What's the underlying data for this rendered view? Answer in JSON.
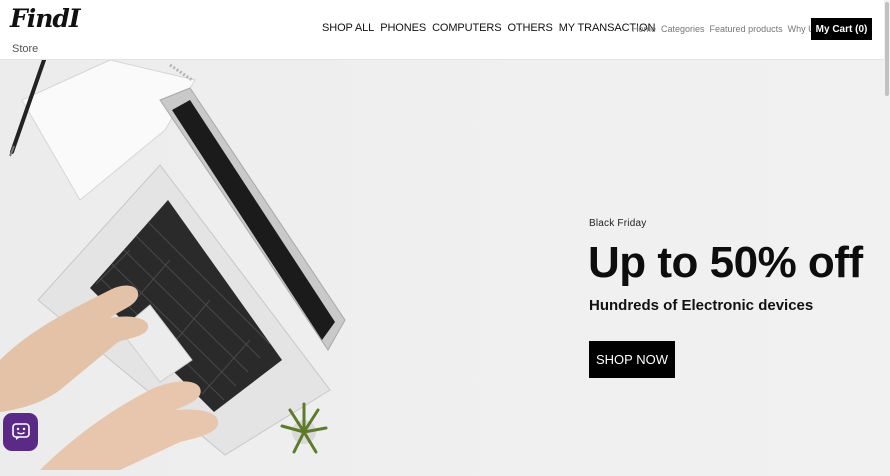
{
  "brand": {
    "logo": "FindI",
    "subtitle": "Store"
  },
  "main_nav": [
    "SHOP ALL",
    "PHONES",
    "COMPUTERS",
    "OTHERS",
    "MY TRANSACTION"
  ],
  "sub_nav": [
    "Home",
    "Categories",
    "Featured products",
    "Why Us"
  ],
  "cart": {
    "label": "My Cart (0)"
  },
  "hero": {
    "eyebrow": "Black Friday",
    "headline": "Up to 50% off",
    "subline": "Hundreds of Electronic devices",
    "cta": "SHOP NOW"
  },
  "icons": {
    "chat": "chat-bubble-icon"
  },
  "colors": {
    "accent": "#000000",
    "chat_button": "#5b2a86",
    "hero_bg": "#efefef"
  }
}
